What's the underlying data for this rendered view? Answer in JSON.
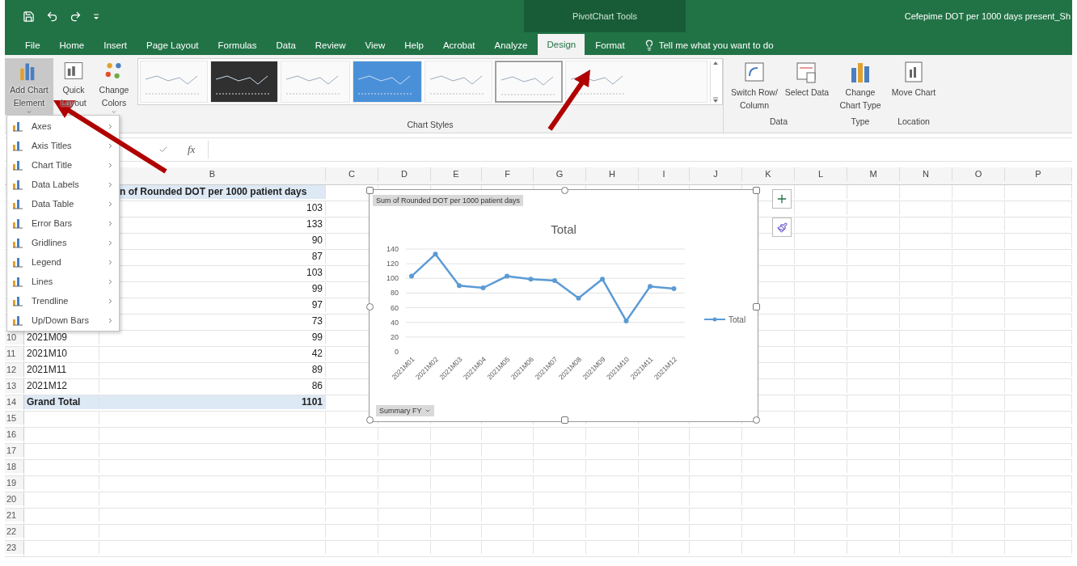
{
  "title_bar": {
    "context_label": "PivotChart Tools",
    "title": "Cefepime DOT per 1000 days present_Sh"
  },
  "tabs": [
    {
      "label": "File",
      "selected": false
    },
    {
      "label": "Home",
      "selected": false
    },
    {
      "label": "Insert",
      "selected": false
    },
    {
      "label": "Page Layout",
      "selected": false
    },
    {
      "label": "Formulas",
      "selected": false
    },
    {
      "label": "Data",
      "selected": false
    },
    {
      "label": "Review",
      "selected": false
    },
    {
      "label": "View",
      "selected": false
    },
    {
      "label": "Help",
      "selected": false
    },
    {
      "label": "Acrobat",
      "selected": false
    },
    {
      "label": "Analyze",
      "selected": false
    },
    {
      "label": "Design",
      "selected": true
    },
    {
      "label": "Format",
      "selected": false
    }
  ],
  "tell_me": {
    "placeholder": "Tell me what you want to do"
  },
  "ribbon": {
    "left_buttons": [
      {
        "label": "Add Chart Element",
        "kind": "element",
        "expanded": true
      },
      {
        "label": "Quick Layout",
        "kind": "layout",
        "expanded": false
      },
      {
        "label": "Change Colors",
        "kind": "colors",
        "expanded": false
      }
    ],
    "chart_styles": {
      "label": "Chart Styles",
      "styles": [
        {
          "kind": "light",
          "selected": false
        },
        {
          "kind": "dark",
          "selected": false
        },
        {
          "kind": "light",
          "selected": false
        },
        {
          "kind": "blue",
          "selected": false
        },
        {
          "kind": "light",
          "selected": false
        },
        {
          "kind": "light",
          "selected": true
        },
        {
          "kind": "light",
          "selected": false
        }
      ]
    },
    "groups": [
      {
        "label": "Data",
        "buttons": [
          {
            "label": "Switch Row/ Column",
            "kind": "switch"
          },
          {
            "label": "Select Data",
            "kind": "select"
          }
        ]
      },
      {
        "label": "Type",
        "buttons": [
          {
            "label": "Change Chart Type",
            "kind": "type"
          }
        ]
      },
      {
        "label": "Location",
        "buttons": [
          {
            "label": "Move Chart",
            "kind": "move"
          }
        ]
      }
    ]
  },
  "chart_element_menu": {
    "items": [
      {
        "label": "Axes"
      },
      {
        "label": "Axis Titles"
      },
      {
        "label": "Chart Title"
      },
      {
        "label": "Data Labels"
      },
      {
        "label": "Data Table"
      },
      {
        "label": "Error Bars"
      },
      {
        "label": "Gridlines"
      },
      {
        "label": "Legend"
      },
      {
        "label": "Lines"
      },
      {
        "label": "Trendline"
      },
      {
        "label": "Up/Down Bars"
      }
    ]
  },
  "formula_bar": {
    "function_label": "fx"
  },
  "sheet": {
    "columns": [
      "B",
      "C",
      "D",
      "E",
      "F",
      "G",
      "H",
      "I",
      "J",
      "K",
      "L",
      "M",
      "N",
      "O",
      "P"
    ],
    "rows": [
      {
        "value": "n of Rounded DOT per 1000 patient days",
        "kind": "header"
      },
      {
        "value": "103"
      },
      {
        "value": "133"
      },
      {
        "value": "90"
      },
      {
        "value": "87"
      },
      {
        "value": "103"
      },
      {
        "value": "99"
      },
      {
        "value": "97"
      },
      {
        "value": "73"
      },
      {
        "num": "10",
        "label": "2021M09",
        "value": "99"
      },
      {
        "num": "11",
        "label": "2021M10",
        "value": "42"
      },
      {
        "num": "12",
        "label": "2021M11",
        "value": "89"
      },
      {
        "num": "13",
        "label": "2021M12",
        "value": "86"
      },
      {
        "num": "14",
        "label": "Grand Total",
        "value": "1101",
        "kind": "total"
      },
      {
        "num": "15"
      },
      {
        "num": "16"
      },
      {
        "num": "17"
      },
      {
        "num": "18"
      },
      {
        "num": "19"
      },
      {
        "num": "20"
      },
      {
        "num": "21"
      },
      {
        "num": "22"
      },
      {
        "num": "23"
      }
    ]
  },
  "chart": {
    "field_button": "Sum of Rounded DOT per 1000 patient days",
    "filter_button": "Summary FY",
    "chart_data": {
      "type": "line",
      "title": "Total",
      "categories": [
        "2021M01",
        "2021M02",
        "2021M03",
        "2021M04",
        "2021M05",
        "2021M06",
        "2021M07",
        "2021M08",
        "2021M09",
        "2021M10",
        "2021M11",
        "2021M12"
      ],
      "grid": true,
      "series": [
        {
          "name": "Total",
          "color": "#5b9bd5",
          "marker": "circle",
          "values": [
            103,
            133,
            90,
            87,
            103,
            99,
            97,
            73,
            99,
            42,
            89,
            86
          ]
        }
      ],
      "ylim": [
        0,
        140
      ],
      "yticks": [
        0,
        20,
        40,
        60,
        80,
        100,
        120,
        140
      ]
    }
  }
}
